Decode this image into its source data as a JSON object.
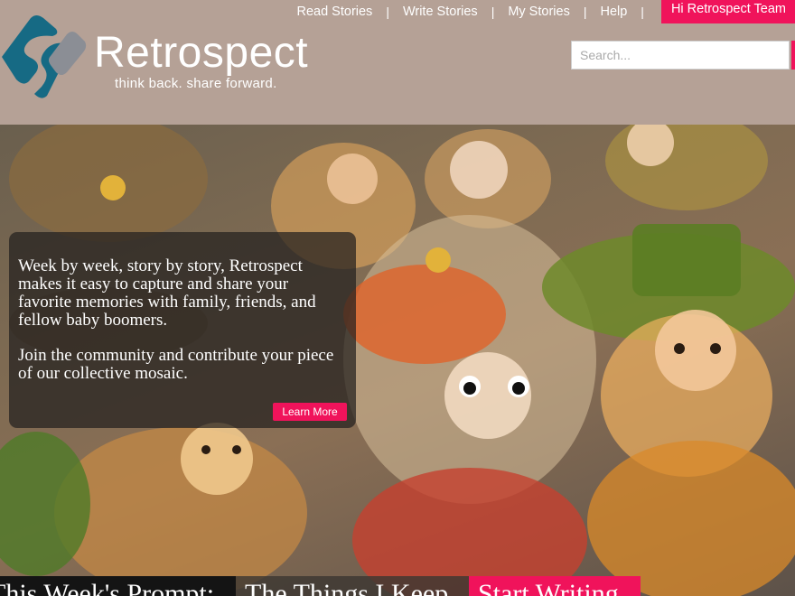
{
  "nav": {
    "items": [
      "Read Stories",
      "Write Stories",
      "My Stories",
      "Help"
    ],
    "separator": "|",
    "greeting": "Hi Retrospect Team"
  },
  "brand": {
    "name": "Retrospect",
    "tagline": "think back. share forward.",
    "logo_icon": "retrospect-logo-icon",
    "colors": {
      "logo_teal": "#166a84",
      "logo_gray": "#8b8e95",
      "accent": "#f0135b",
      "header_bg": "#b5a196"
    }
  },
  "search": {
    "placeholder": "Search...",
    "value": ""
  },
  "hero": {
    "intro": "Week by week, story by story, Retrospect makes it easy to capture and share your favorite memories with family, friends, and fellow baby boomers.",
    "join": "Join the community and contribute your piece of our collective mosaic.",
    "learn_more": "Learn More"
  },
  "prompt_bar": {
    "label": "This Week's Prompt:",
    "prompt": "The Things I Keep",
    "cta": "Start Writing"
  }
}
